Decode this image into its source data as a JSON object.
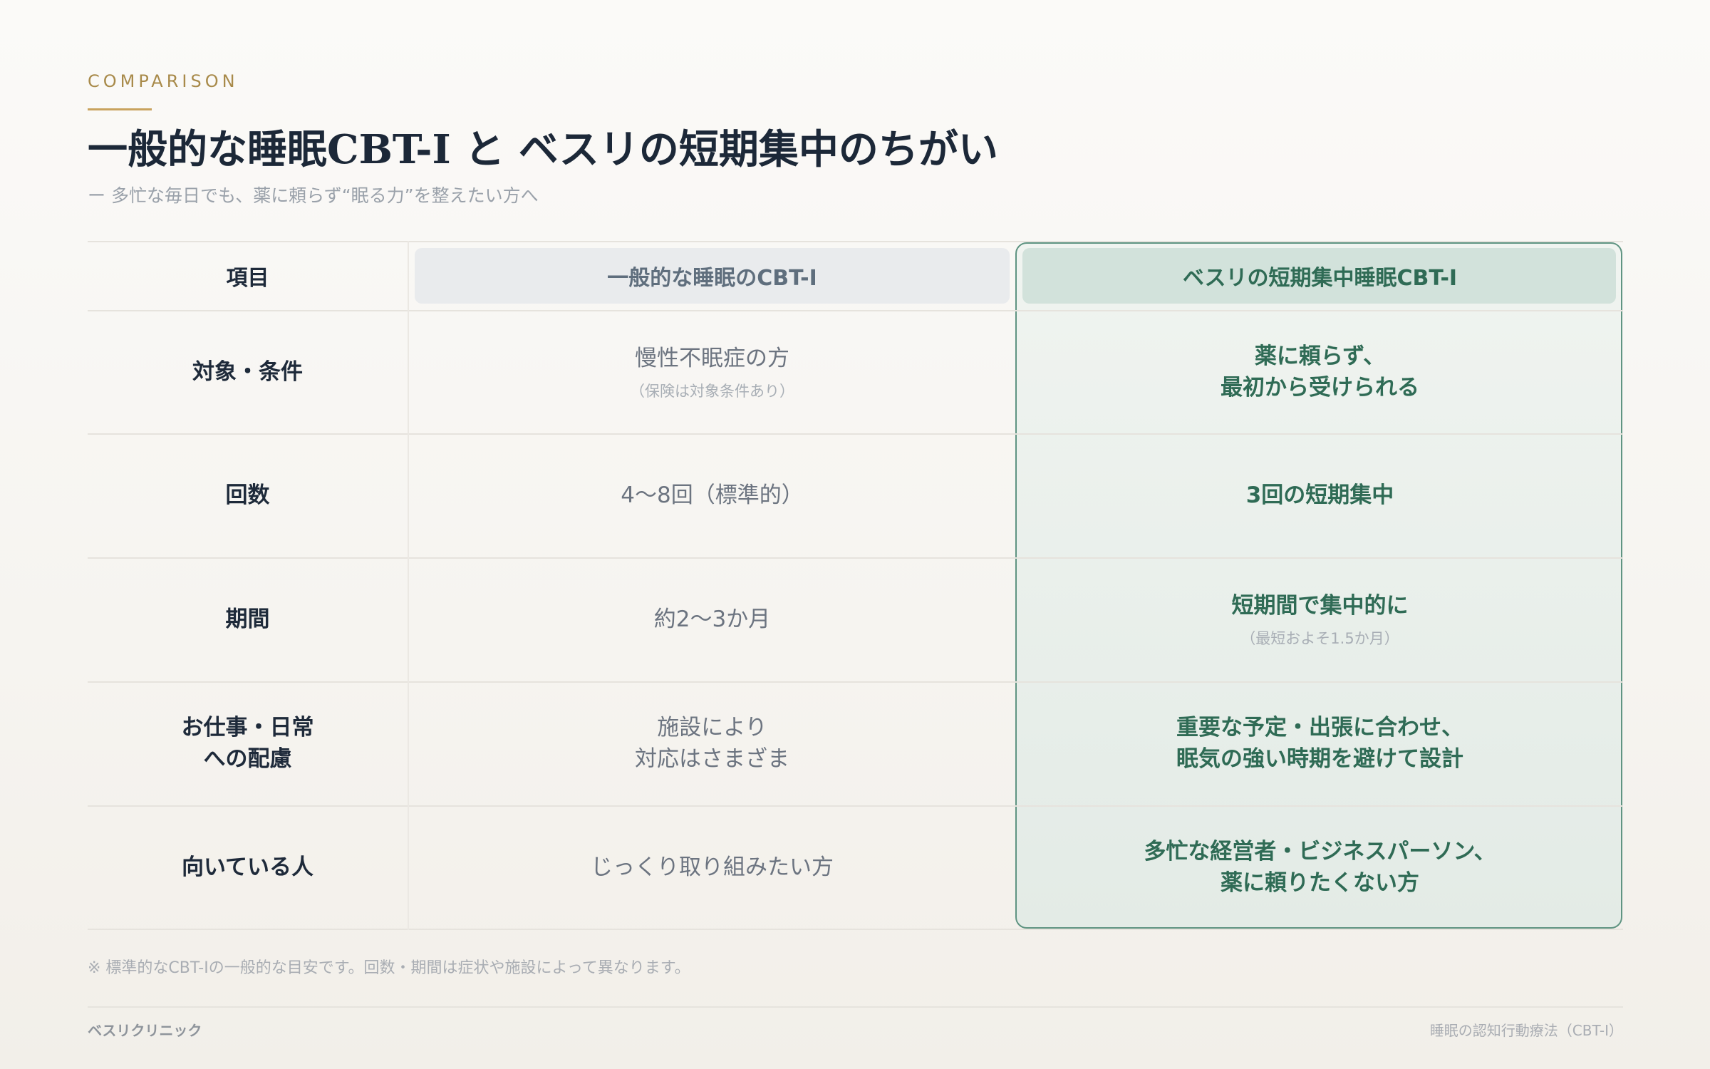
{
  "header": {
    "eyebrow": "COMPARISON",
    "title": "一般的な睡眠CBT-I と ベスリの短期集中のちがい",
    "subtitle": "ー 多忙な毎日でも、薬に頼らず“眠る力”を整えたい方へ"
  },
  "table": {
    "columns": {
      "label": "項目",
      "general": "一般的な睡眠のCBT-I",
      "best": "ベスリの短期集中睡眠CBT-I"
    },
    "rows": [
      {
        "label": "対象・条件",
        "general": "慢性不眠症の方",
        "general_note": "（保険は対象条件あり）",
        "best": "薬に頼らず、\n最初から受けられる",
        "best_note": ""
      },
      {
        "label": "回数",
        "general": "4〜8回（標準的）",
        "general_note": "",
        "best": "3回の短期集中",
        "best_note": ""
      },
      {
        "label": "期間",
        "general": "約2〜3か月",
        "general_note": "",
        "best": "短期間で集中的に",
        "best_note": "（最短およそ1.5か月）"
      },
      {
        "label": "お仕事・日常\nへの配慮",
        "general": "施設により\n対応はさまざま",
        "general_note": "",
        "best": "重要な予定・出張に合わせ、\n眠気の強い時期を避けて設計",
        "best_note": ""
      },
      {
        "label": "向いている人",
        "general": "じっくり取り組みたい方",
        "general_note": "",
        "best": "多忙な経営者・ビジネスパーソン、\n薬に頼りたくない方",
        "best_note": ""
      }
    ]
  },
  "footnote": "※ 標準的なCBT-Iの一般的な目安です。回数・期間は症状や施設によって異なります。",
  "footer": {
    "left": "ベスリクリニック",
    "right": "睡眠の認知行動療法（CBT-I）"
  }
}
